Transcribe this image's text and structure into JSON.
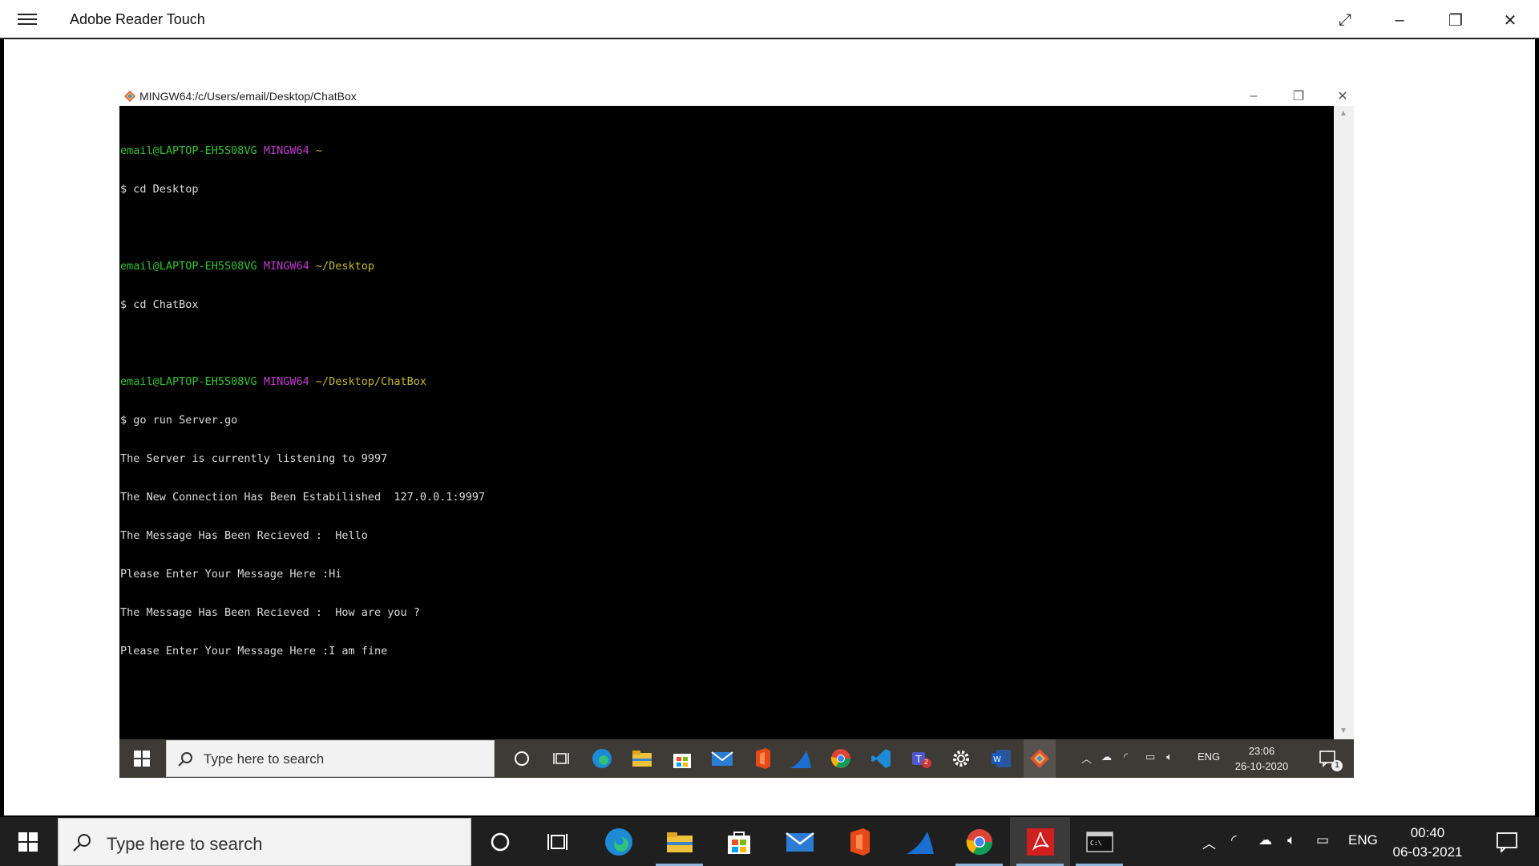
{
  "app": {
    "title": "Adobe Reader Touch",
    "controls": {
      "fullscreen": "⤢",
      "minimize": "–",
      "restore": "❐",
      "close": "✕"
    }
  },
  "terminal_window": {
    "title": "MINGW64:/c/Users/email/Desktop/ChatBox",
    "controls": {
      "minimize": "–",
      "restore": "❐",
      "close": "✕"
    },
    "prompts": [
      {
        "user": "email@LAPTOP-EH5S08VG",
        "host": "MINGW64",
        "path": "~",
        "command": "$ cd Desktop"
      },
      {
        "user": "email@LAPTOP-EH5S08VG",
        "host": "MINGW64",
        "path": "~/Desktop",
        "command": "$ cd ChatBox"
      },
      {
        "user": "email@LAPTOP-EH5S08VG",
        "host": "MINGW64",
        "path": "~/Desktop/ChatBox",
        "command": "$ go run Server.go"
      }
    ],
    "output": [
      "The Server is currently listening to 9997",
      "The New Connection Has Been Estabilished  127.0.0.1:9997",
      "The Message Has Been Recieved :  Hello",
      "Please Enter Your Message Here :Hi",
      "The Message Has Been Recieved :  How are you ?",
      "Please Enter Your Message Here :I am fine"
    ]
  },
  "inner_taskbar": {
    "search_placeholder": "Type here to search",
    "lang": "ENG",
    "time": "23:06",
    "date": "26-10-2020",
    "notification_count": "1",
    "teams_badge": "2",
    "icons": [
      "cortana-icon",
      "task-view-icon",
      "edge-icon",
      "file-explorer-icon",
      "store-icon",
      "mail-icon",
      "office-icon",
      "wireshark-icon",
      "chrome-icon",
      "vscode-icon",
      "teams-icon",
      "settings-icon",
      "word-icon",
      "git-icon"
    ]
  },
  "taskbar": {
    "search_placeholder": "Type here to search",
    "lang": "ENG",
    "time": "00:40",
    "date": "06-03-2021",
    "icons": [
      "cortana-icon",
      "task-view-icon",
      "edge-icon",
      "file-explorer-icon",
      "store-icon",
      "mail-icon",
      "office-icon",
      "wireshark-icon",
      "chrome-icon",
      "acrobat-icon",
      "terminal-icon"
    ]
  },
  "colors": {
    "prompt_user": "#2ec430",
    "prompt_host": "#c23ccd",
    "prompt_path": "#c8b928",
    "taskbar_bg": "#1f1f1f",
    "inner_taskbar_bg": "#3e3a36"
  }
}
